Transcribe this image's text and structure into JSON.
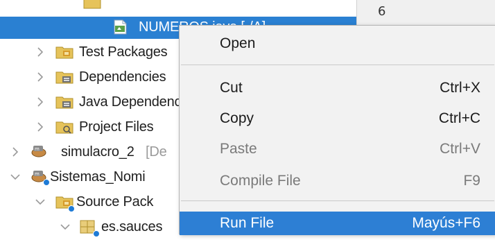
{
  "tree": {
    "partial_top_row": "",
    "rows": [
      {
        "label": "NUMEROS.java [-/A]",
        "icon": "java-file-icon",
        "selected": true
      },
      {
        "label": "Test Packages",
        "icon": "test-packages-folder-icon"
      },
      {
        "label": "Dependencies",
        "icon": "dependencies-folder-icon"
      },
      {
        "label": "Java Dependencies",
        "icon": "java-dependencies-folder-icon"
      },
      {
        "label": "Project Files",
        "icon": "project-files-folder-icon"
      },
      {
        "label": "simulacro_2",
        "suffix": "[De",
        "icon": "maven-project-icon"
      },
      {
        "label": "Sistemas_Nomi",
        "icon": "maven-project-icon"
      },
      {
        "label": "Source Pack",
        "icon": "source-packages-folder-icon"
      },
      {
        "label": "es.sauces",
        "icon": "package-icon"
      }
    ]
  },
  "gutter": {
    "line_number": "6"
  },
  "menu": {
    "items": [
      {
        "label": "Open",
        "shortcut": "",
        "enabled": true
      },
      {
        "label": "Cut",
        "shortcut": "Ctrl+X",
        "enabled": true
      },
      {
        "label": "Copy",
        "shortcut": "Ctrl+C",
        "enabled": true
      },
      {
        "label": "Paste",
        "shortcut": "Ctrl+V",
        "enabled": false
      },
      {
        "label": "Compile File",
        "shortcut": "F9",
        "enabled": false
      },
      {
        "label": "Run File",
        "shortcut": "Mayús+F6",
        "enabled": true,
        "active": true
      }
    ]
  },
  "colors": {
    "selection": "#2a80d2",
    "menu_bg": "#f2f2f2",
    "menu_active": "#2d7fd4",
    "disabled_text": "#7a7a7a",
    "folder_yellow": "#e6c35a",
    "badge_blue": "#1f7bd6"
  }
}
